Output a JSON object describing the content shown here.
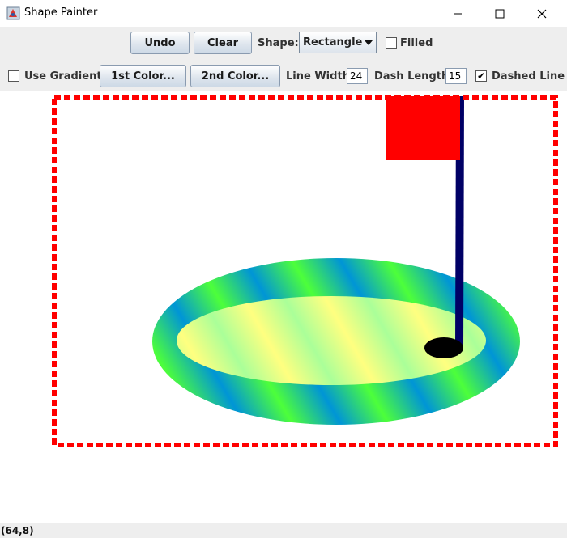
{
  "window": {
    "title": "Shape Painter",
    "controls": [
      "minimize",
      "maximize",
      "close"
    ]
  },
  "toolbar1": {
    "undo_label": "Undo",
    "clear_label": "Clear",
    "shape_label": "Shape:",
    "shape_value": "Rectangle",
    "filled_label": "Filled",
    "filled_checked": false
  },
  "toolbar2": {
    "gradient_label": "Use Gradient",
    "gradient_checked": false,
    "color1_label": "1st Color...",
    "color2_label": "2nd Color...",
    "line_width_label": "Line Width:",
    "line_width_value": "24",
    "dash_length_label": "Dash Length:",
    "dash_length_value": "15",
    "dashed_label": "Dashed Line",
    "dashed_checked": true,
    "dashed_mark": "✔"
  },
  "canvas": {
    "shapes": [
      {
        "name": "dashed-rectangle",
        "type": "rectangle",
        "stroke": "#ff0000",
        "dashed": true,
        "filled": false
      },
      {
        "name": "green-oval",
        "type": "oval",
        "gradient": [
          "#4dff3a",
          "#0095d6"
        ],
        "filled": true
      },
      {
        "name": "light-inner-oval",
        "type": "oval",
        "gradient": [
          "#aaff99",
          "#ffff80"
        ],
        "filled": true
      },
      {
        "name": "flag-pole",
        "type": "line",
        "stroke": "#000066"
      },
      {
        "name": "flag",
        "type": "rectangle",
        "fill": "#ff0000",
        "filled": true
      },
      {
        "name": "hole",
        "type": "oval",
        "fill": "#000000",
        "filled": true
      }
    ]
  },
  "status": {
    "coordinates": "(64,8)"
  },
  "colors": {
    "toolbar_bg": "#eeeeee",
    "dash_red": "#ff0000",
    "pole_navy": "#000066"
  }
}
